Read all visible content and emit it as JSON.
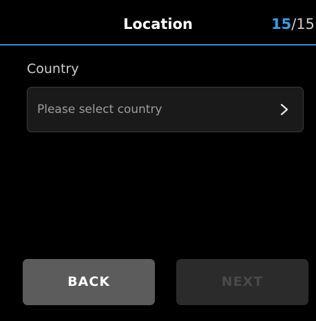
{
  "header": {
    "title": "Location",
    "step_current": "15",
    "step_separator": "/",
    "step_total": "15",
    "accent_color": "#3a9be8"
  },
  "form": {
    "country_label": "Country",
    "country_placeholder": "Please select country",
    "chevron_icon": "chevron-right-icon"
  },
  "footer": {
    "back_label": "BACK",
    "next_label": "NEXT",
    "next_disabled": true
  }
}
